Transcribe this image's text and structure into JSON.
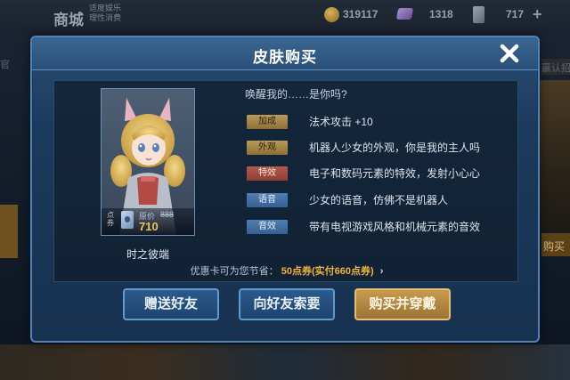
{
  "background": {
    "store_title": "商城",
    "store_subtitle_line1": "适度娱乐",
    "store_subtitle_line2": "理性消费",
    "gold_amount": "319117",
    "gem_amount": "1318",
    "ticket_amount": "717",
    "plus_symbol": "+",
    "left_edge_text": "官",
    "right_edge_text": "赢认招",
    "right_edge_buy": "购买"
  },
  "dialog": {
    "title": "皮肤购买",
    "close_symbol": "✕",
    "skin": {
      "name": "时之彼端",
      "ticket_label": "点券",
      "original_label": "原价",
      "original_price": "888",
      "current_price": "710"
    },
    "tagline": "唤醒我的……是你吗?",
    "features": [
      {
        "badge": "加成",
        "text": "法术攻击 +10",
        "style": "gold"
      },
      {
        "badge": "外观",
        "text": "机器人少女的外观，你是我的主人吗",
        "style": "gold"
      },
      {
        "badge": "特效",
        "text": "电子和数码元素的特效，发射小心心",
        "style": "red"
      },
      {
        "badge": "语音",
        "text": "少女的语音，仿佛不是机器人",
        "style": "blue"
      },
      {
        "badge": "音效",
        "text": "带有电视游戏风格和机械元素的音效",
        "style": "blue"
      }
    ],
    "promo": {
      "prefix": "优惠卡可为您节省：",
      "highlight": "50点券(实付660点券)",
      "arrow": "›"
    },
    "buttons": {
      "gift": "赠送好友",
      "request": "向好友索要",
      "buy": "购买并穿戴"
    }
  },
  "colors": {
    "accent_gold": "#f0c45a",
    "dialog_border": "#4d84b8"
  }
}
